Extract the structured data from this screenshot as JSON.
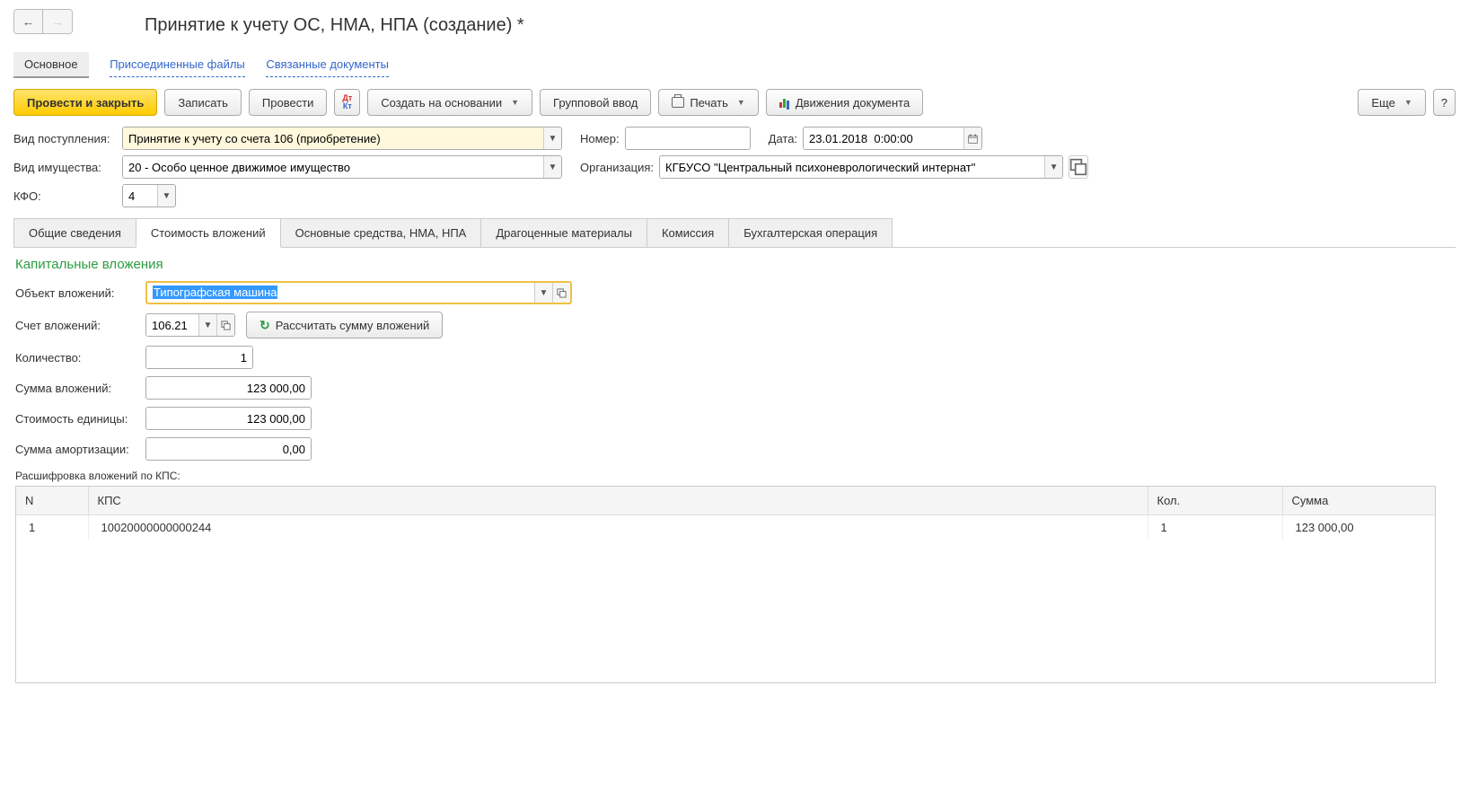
{
  "title": "Принятие к учету ОС, НМА, НПА (создание) *",
  "nav_tabs": {
    "main": "Основное",
    "files": "Присоединенные файлы",
    "related": "Связанные документы"
  },
  "toolbar": {
    "post_close": "Провести и закрыть",
    "save": "Записать",
    "post": "Провести",
    "create_based": "Создать на основании",
    "group_input": "Групповой ввод",
    "print": "Печать",
    "movements": "Движения документа",
    "more": "Еще",
    "help": "?"
  },
  "header": {
    "receipt_type_label": "Вид поступления:",
    "receipt_type_value": "Принятие к учету со счета 106 (приобретение)",
    "number_label": "Номер:",
    "number_value": "",
    "date_label": "Дата:",
    "date_value": "23.01.2018  0:00:00",
    "asset_type_label": "Вид имущества:",
    "asset_type_value": "20 - Особо ценное движимое имущество",
    "org_label": "Организация:",
    "org_value": "КГБУСО \"Центральный психоневрологический интернат\"",
    "kfo_label": "КФО:",
    "kfo_value": "4"
  },
  "tabs": {
    "general": "Общие сведения",
    "investment_cost": "Стоимость вложений",
    "assets": "Основные средства, НМА, НПА",
    "precious": "Драгоценные материалы",
    "commission": "Комиссия",
    "acc_op": "Бухгалтерская операция"
  },
  "investment": {
    "section_title": "Капитальные вложения",
    "object_label": "Объект вложений:",
    "object_value": "Типографская машина",
    "account_label": "Счет вложений:",
    "account_value": "106.21",
    "calc_btn": "Рассчитать сумму вложений",
    "qty_label": "Количество:",
    "qty_value": "1",
    "sum_label": "Сумма вложений:",
    "sum_value": "123 000,00",
    "unit_cost_label": "Стоимость единицы:",
    "unit_cost_value": "123 000,00",
    "amort_label": "Сумма амортизации:",
    "amort_value": "0,00"
  },
  "table": {
    "caption": "Расшифровка вложений по КПС:",
    "cols": {
      "n": "N",
      "kps": "КПС",
      "qty": "Кол.",
      "sum": "Сумма"
    },
    "rows": [
      {
        "n": "1",
        "kps": "10020000000000244",
        "qty": "1",
        "sum": "123 000,00"
      }
    ]
  }
}
